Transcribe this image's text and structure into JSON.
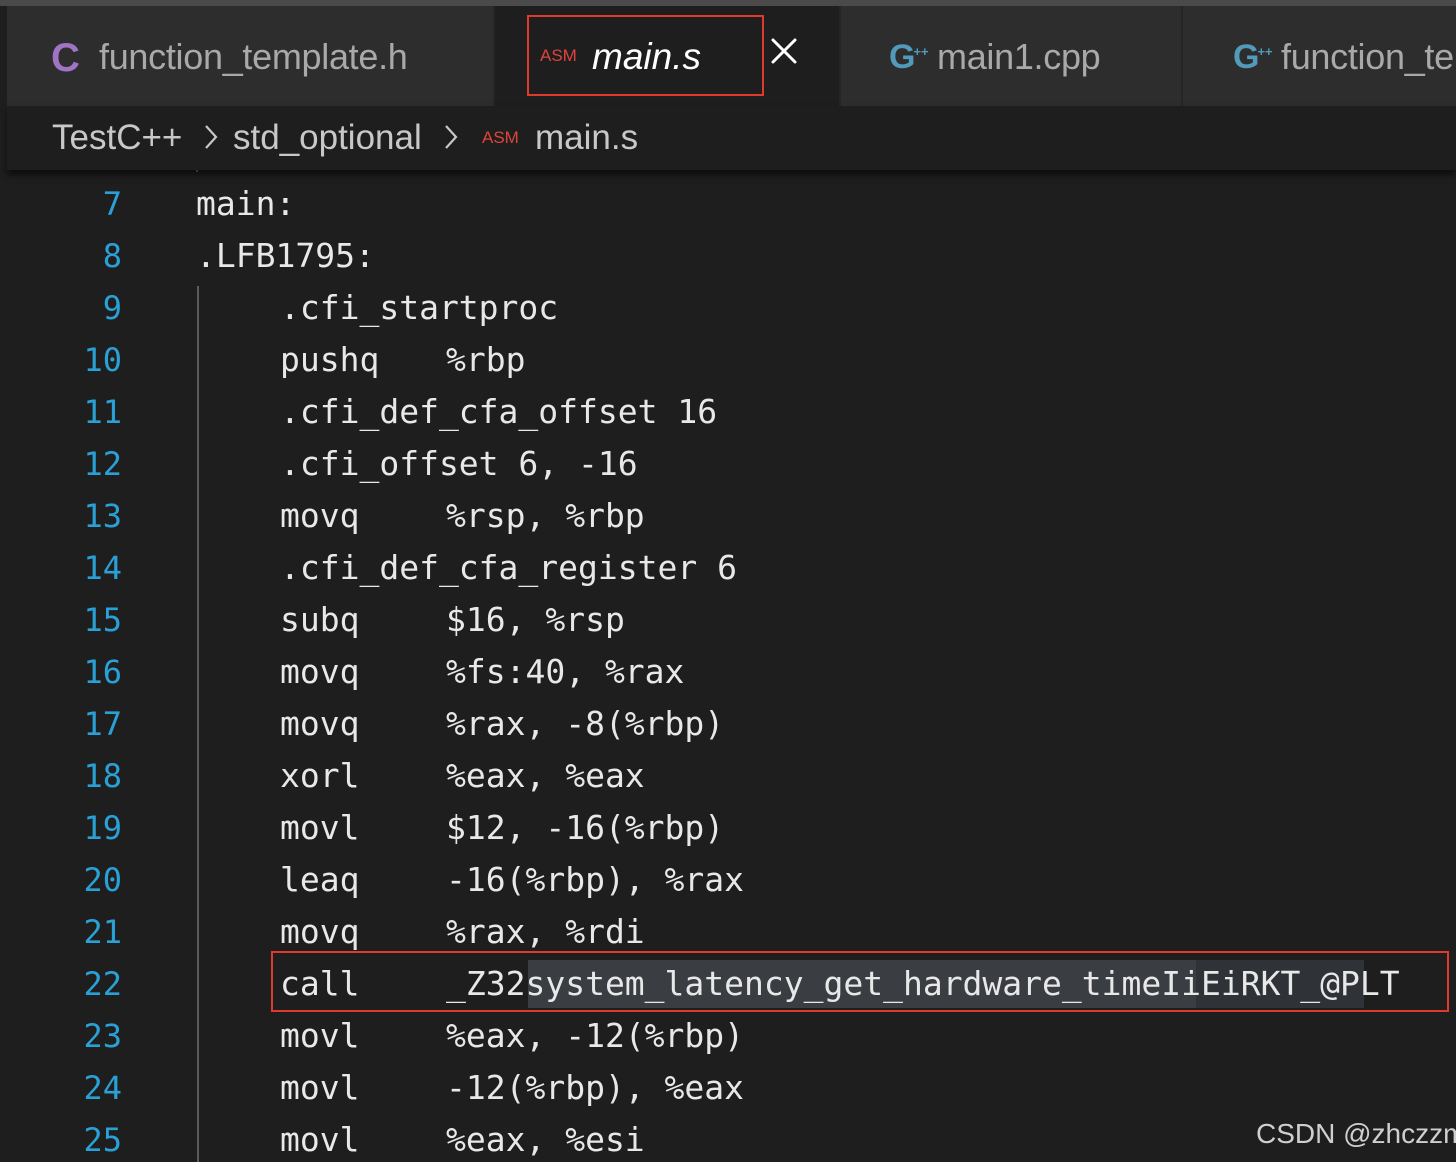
{
  "tabs": [
    {
      "label": "function_template.h",
      "icon": "c-header-icon",
      "icon_text": "C"
    },
    {
      "label": "main.s",
      "icon": "asm-icon",
      "icon_text": "ASM",
      "active": true
    },
    {
      "label": "main1.cpp",
      "icon": "cpp-icon",
      "icon_text": "G",
      "icon_sup": "++"
    },
    {
      "label": "function_te",
      "icon": "cpp-icon",
      "icon_text": "G",
      "icon_sup": "++"
    }
  ],
  "breadcrumb": {
    "items": [
      "TestC++",
      "std_optional",
      "main.s"
    ],
    "file_icon_text": "ASM"
  },
  "code": {
    "lines": [
      {
        "n": "7",
        "text": "main:",
        "kind": "label"
      },
      {
        "n": "8",
        "text": ".LFB1795:",
        "kind": "label"
      },
      {
        "n": "9",
        "text": ".cfi_startproc",
        "kind": "instr"
      },
      {
        "n": "10",
        "text": "pushq",
        "operands": "%rbp",
        "kind": "instr"
      },
      {
        "n": "11",
        "text": ".cfi_def_cfa_offset 16",
        "kind": "instr"
      },
      {
        "n": "12",
        "text": ".cfi_offset 6, -16",
        "kind": "instr"
      },
      {
        "n": "13",
        "text": "movq",
        "operands": "%rsp, %rbp",
        "kind": "instr"
      },
      {
        "n": "14",
        "text": ".cfi_def_cfa_register 6",
        "kind": "instr"
      },
      {
        "n": "15",
        "text": "subq",
        "operands": "$16, %rsp",
        "kind": "instr"
      },
      {
        "n": "16",
        "text": "movq",
        "operands": "%fs:40, %rax",
        "kind": "instr"
      },
      {
        "n": "17",
        "text": "movq",
        "operands": "%rax, -8(%rbp)",
        "kind": "instr"
      },
      {
        "n": "18",
        "text": "xorl",
        "operands": "%eax, %eax",
        "kind": "instr"
      },
      {
        "n": "19",
        "text": "movl",
        "operands": "$12, -16(%rbp)",
        "kind": "instr"
      },
      {
        "n": "20",
        "text": "leaq",
        "operands": "-16(%rbp), %rax",
        "kind": "instr"
      },
      {
        "n": "21",
        "text": "movq",
        "operands": "%rax, %rdi",
        "kind": "instr"
      },
      {
        "n": "22",
        "text": "call",
        "operands": "_Z32system_latency_get_hardware_timeIiEiRKT_@PLT",
        "kind": "instr"
      },
      {
        "n": "23",
        "text": "movl",
        "operands": "%eax, -12(%rbp)",
        "kind": "instr"
      },
      {
        "n": "24",
        "text": "movl",
        "operands": "-12(%rbp), %eax",
        "kind": "instr"
      },
      {
        "n": "25",
        "text": "movl",
        "operands": "%eax, %esi",
        "kind": "instr"
      }
    ]
  },
  "watermark": "CSDN @zhczzm",
  "colors": {
    "line_number": "#2aa1d6",
    "highlight_box": "#e03a2e",
    "asm_icon": "#e0433c",
    "c_icon": "#a074c4",
    "cpp_icon": "#519aba"
  }
}
